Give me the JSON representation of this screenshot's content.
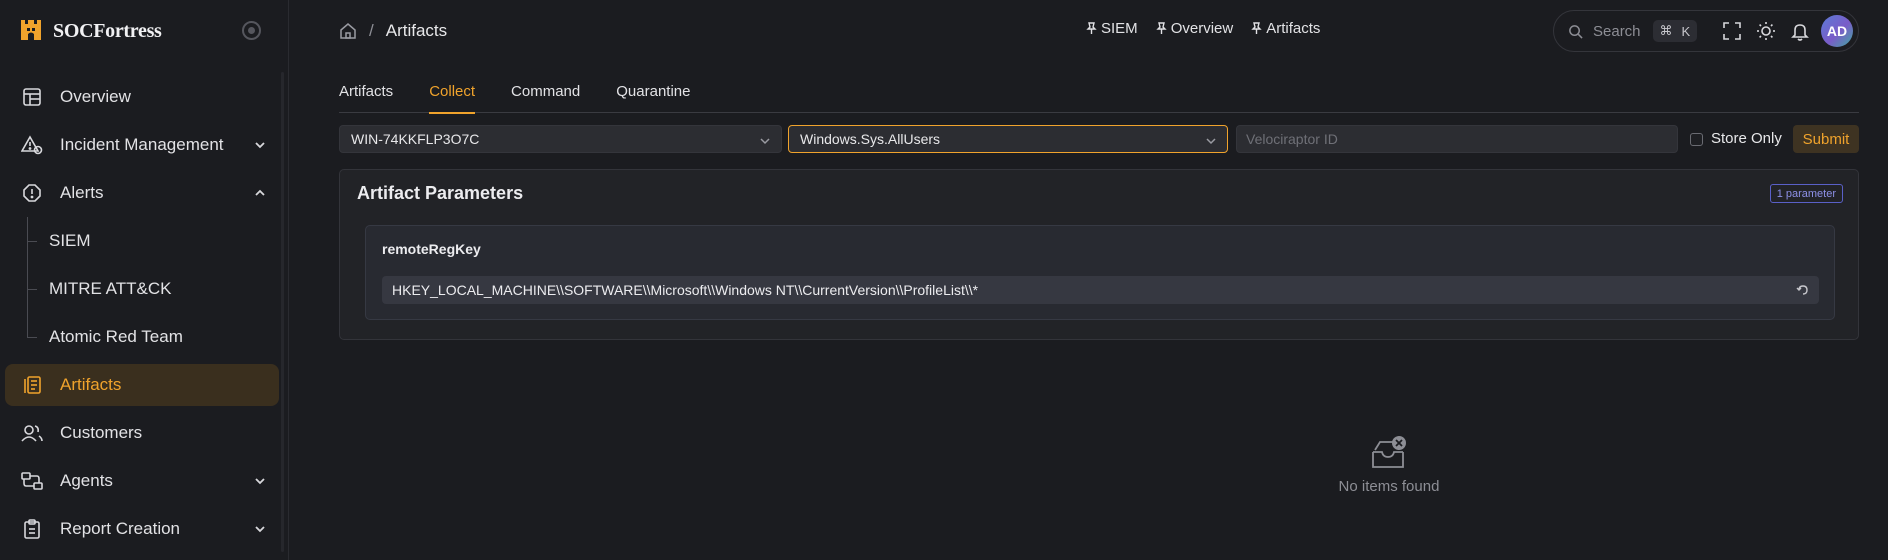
{
  "brand": {
    "name": "SOCFortress"
  },
  "sidebar": {
    "items": [
      {
        "label": "Overview",
        "icon": "dashboard-icon"
      },
      {
        "label": "Incident Management",
        "icon": "incident-icon",
        "expandable": true
      },
      {
        "label": "Alerts",
        "icon": "alert-icon",
        "expanded": true
      },
      {
        "label": "Artifacts",
        "icon": "artifacts-icon",
        "active": true
      },
      {
        "label": "Customers",
        "icon": "customers-icon"
      },
      {
        "label": "Agents",
        "icon": "agents-icon",
        "expandable": true
      },
      {
        "label": "Report Creation",
        "icon": "report-icon",
        "expandable": true
      }
    ],
    "alerts_sub": [
      "SIEM",
      "MITRE ATT&CK",
      "Atomic Red Team"
    ]
  },
  "header": {
    "breadcrumb_current": "Artifacts",
    "pins": [
      "SIEM",
      "Overview",
      "Artifacts"
    ],
    "search_placeholder": "Search",
    "search_shortcut_mod": "⌘",
    "search_shortcut_key": "K",
    "avatar_initials": "AD"
  },
  "tabs": [
    "Artifacts",
    "Collect",
    "Command",
    "Quarantine"
  ],
  "active_tab": "Collect",
  "form": {
    "agent_select": "WIN-74KKFLP3O7C",
    "artifact_select": "Windows.Sys.AllUsers",
    "velociraptor_placeholder": "Velociraptor ID",
    "store_only_label": "Store Only",
    "submit_label": "Submit"
  },
  "parameters": {
    "title": "Artifact Parameters",
    "badge": "1 parameter",
    "items": [
      {
        "name": "remoteRegKey",
        "value": "HKEY_LOCAL_MACHINE\\\\SOFTWARE\\\\Microsoft\\\\Windows NT\\\\CurrentVersion\\\\ProfileList\\\\*"
      }
    ]
  },
  "empty_state": {
    "text": "No items found"
  },
  "colors": {
    "accent": "#f0a32c",
    "bg": "#1b1c20",
    "badge": "#8d90e6"
  }
}
